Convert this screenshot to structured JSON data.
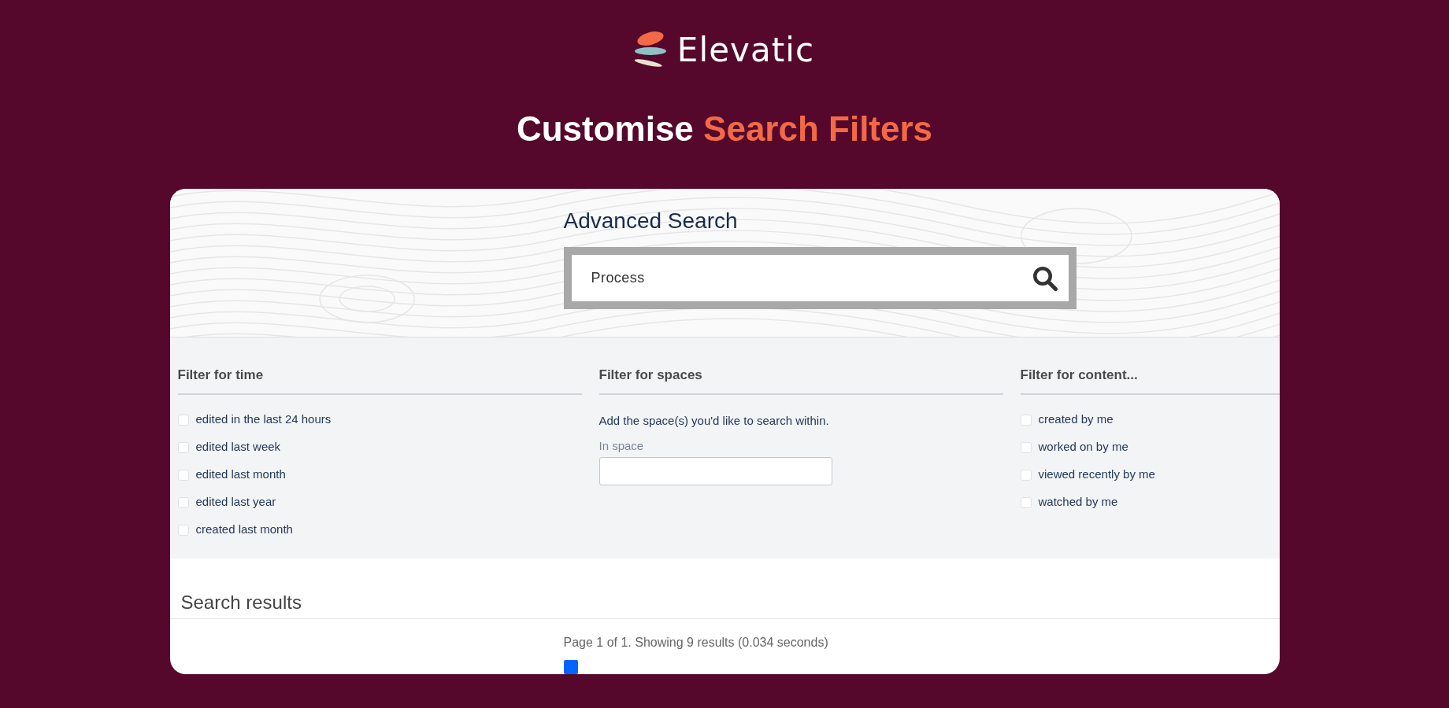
{
  "brand": {
    "name": "Elevatic"
  },
  "headline": {
    "text": "Customise ",
    "highlight": "Search Filters"
  },
  "page": {
    "title": "Advanced Search",
    "search": {
      "value": "Process"
    },
    "filters": [
      {
        "kind": "checklist",
        "heading": "Filter for time",
        "options": [
          {
            "label": "edited in the last 24 hours",
            "checked": false
          },
          {
            "label": "edited last week",
            "checked": false
          },
          {
            "label": "edited last month",
            "checked": false
          },
          {
            "label": "edited last year",
            "checked": false
          },
          {
            "label": "created last month",
            "checked": false
          }
        ]
      },
      {
        "kind": "space",
        "heading": "Filter for spaces",
        "hint": "Add the space(s) you'd like to search within.",
        "field_label": "In space"
      },
      {
        "kind": "checklist",
        "heading": "Filter for content...",
        "options": [
          {
            "label": "created by me",
            "checked": false
          },
          {
            "label": "worked on by me",
            "checked": false
          },
          {
            "label": "viewed recently by me",
            "checked": false
          },
          {
            "label": "watched by me",
            "checked": false
          }
        ]
      }
    ],
    "results": {
      "heading": "Search results",
      "summary": "Page 1 of 1. Showing 9 results (0.034 seconds)"
    }
  }
}
